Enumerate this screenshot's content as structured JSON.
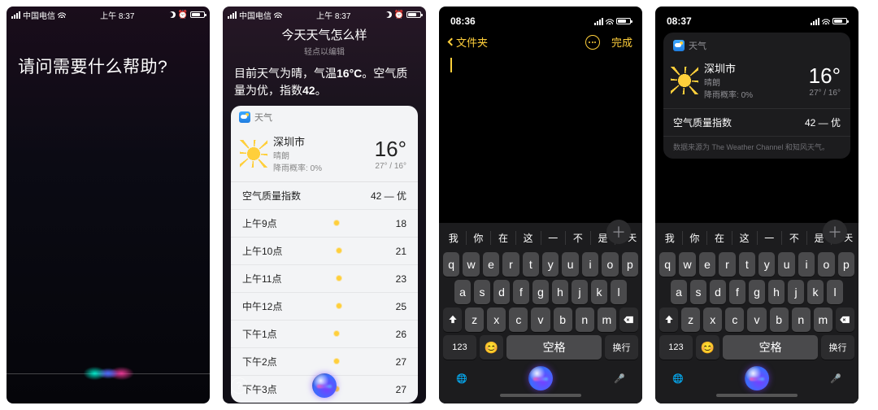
{
  "phones": [
    {
      "status": {
        "carrier": "中国电信",
        "time": "上午 8:37"
      },
      "siri_prompt": "请问需要什么帮助?"
    },
    {
      "status": {
        "carrier": "中国电信",
        "time": "上午 8:37"
      },
      "header": {
        "query": "今天天气怎么样",
        "hint": "轻点以编辑"
      },
      "answer": {
        "prefix": "目前天气为晴，气温",
        "temp_inline": "16°C",
        "mid": "。空气质量为优，指数",
        "aqi_inline": "42",
        "suffix": "。"
      },
      "weather": {
        "app_label": "天气",
        "city": "深圳市",
        "condition": "晴朗",
        "rain_label": "降雨概率:",
        "rain_value": "0%",
        "temp": "16°",
        "range": "27° / 16°",
        "aqi_label": "空气质量指数",
        "aqi_value": "42 — 优",
        "hourly": [
          {
            "t": "上午9点",
            "v": "18"
          },
          {
            "t": "上午10点",
            "v": "21"
          },
          {
            "t": "上午11点",
            "v": "23"
          },
          {
            "t": "中午12点",
            "v": "25"
          },
          {
            "t": "下午1点",
            "v": "26"
          },
          {
            "t": "下午2点",
            "v": "27"
          },
          {
            "t": "下午3点",
            "v": "27"
          }
        ]
      },
      "help_glyph": "?"
    },
    {
      "status": {
        "time": "08:36"
      },
      "nav": {
        "back": "文件夹",
        "done": "完成"
      },
      "keyboard": {
        "suggestions": [
          "我",
          "你",
          "在",
          "这",
          "一",
          "不",
          "是",
          "今天"
        ],
        "rows": [
          [
            "q",
            "w",
            "e",
            "r",
            "t",
            "y",
            "u",
            "i",
            "o",
            "p"
          ],
          [
            "a",
            "s",
            "d",
            "f",
            "g",
            "h",
            "j",
            "k",
            "l"
          ],
          [
            "z",
            "x",
            "c",
            "v",
            "b",
            "n",
            "m"
          ]
        ],
        "num_key": "123",
        "space": "空格",
        "return": "换行"
      }
    },
    {
      "status": {
        "time": "08:37"
      },
      "weather": {
        "app_label": "天气",
        "city": "深圳市",
        "condition": "晴朗",
        "rain_label": "降雨概率:",
        "rain_value": "0%",
        "temp": "16°",
        "range": "27° / 16°",
        "aqi_label": "空气质量指数",
        "aqi_value": "42 — 优",
        "attrib": "数据来源为 The Weather Channel 和知风天气。"
      },
      "keyboard": {
        "suggestions": [
          "我",
          "你",
          "在",
          "这",
          "一",
          "不",
          "是",
          "今天"
        ],
        "rows": [
          [
            "q",
            "w",
            "e",
            "r",
            "t",
            "y",
            "u",
            "i",
            "o",
            "p"
          ],
          [
            "a",
            "s",
            "d",
            "f",
            "g",
            "h",
            "j",
            "k",
            "l"
          ],
          [
            "z",
            "x",
            "c",
            "v",
            "b",
            "n",
            "m"
          ]
        ],
        "num_key": "123",
        "space": "空格",
        "return": "换行"
      }
    }
  ]
}
